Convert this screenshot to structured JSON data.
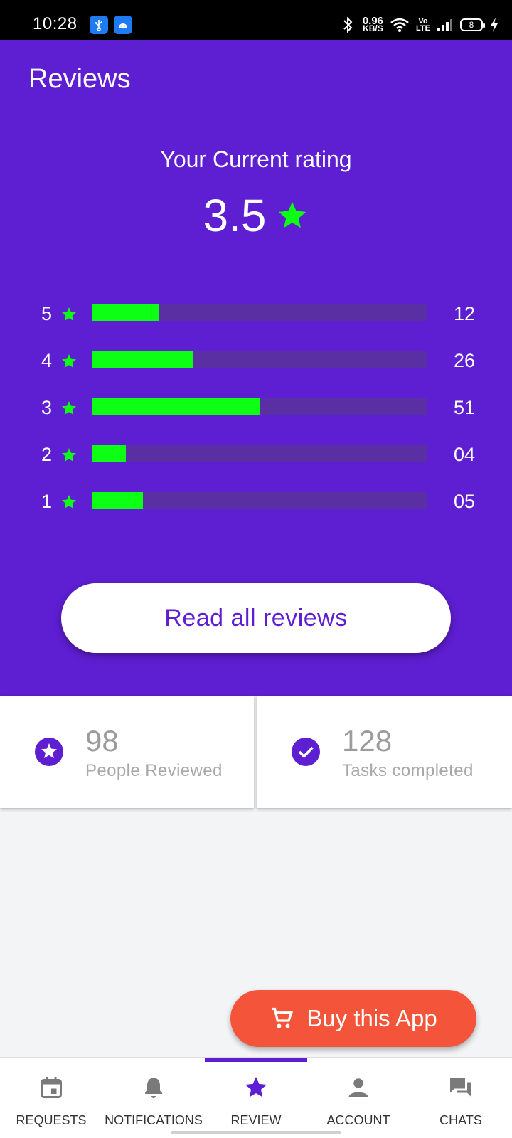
{
  "status_bar": {
    "time": "10:28",
    "net_speed_value": "0.96",
    "net_speed_unit": "KB/S",
    "volte_top": "Vo",
    "volte_bottom": "LTE",
    "battery": "8"
  },
  "header": {
    "title": "Reviews",
    "rating_caption": "Your Current rating",
    "rating_value": "3.5",
    "accent_color": "#5e1ed1",
    "star_color": "#0dff13"
  },
  "rating_breakdown": [
    {
      "stars": "5",
      "count": "12",
      "fill_fraction": 0.2
    },
    {
      "stars": "4",
      "count": "26",
      "fill_fraction": 0.3
    },
    {
      "stars": "3",
      "count": "51",
      "fill_fraction": 0.5
    },
    {
      "stars": "2",
      "count": "04",
      "fill_fraction": 0.1
    },
    {
      "stars": "1",
      "count": "05",
      "fill_fraction": 0.15
    }
  ],
  "read_reviews_label": "Read all reviews",
  "stats": {
    "people_reviewed_value": "98",
    "people_reviewed_label": "People Reviewed",
    "tasks_completed_value": "128",
    "tasks_completed_label": "Tasks completed"
  },
  "buy_button": {
    "label": "Buy this App",
    "color": "#f4553a"
  },
  "bottom_nav": {
    "items": [
      {
        "label": "REQUESTS",
        "icon": "calendar-icon"
      },
      {
        "label": "NOTIFICATIONS",
        "icon": "bell-icon"
      },
      {
        "label": "REVIEW",
        "icon": "star-icon",
        "active": true
      },
      {
        "label": "ACCOUNT",
        "icon": "person-icon"
      },
      {
        "label": "CHATS",
        "icon": "chat-icon"
      }
    ]
  }
}
